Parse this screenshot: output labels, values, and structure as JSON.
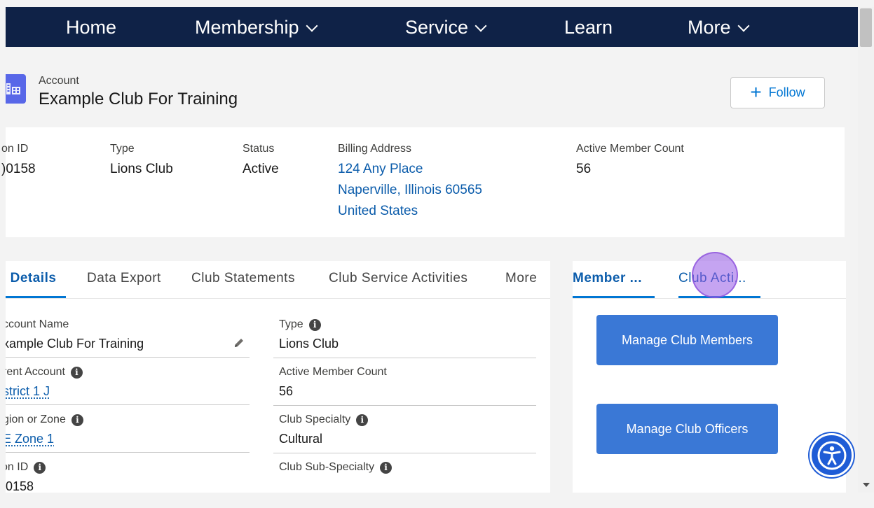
{
  "nav": {
    "items": [
      {
        "label": "Home",
        "dropdown": false
      },
      {
        "label": "Membership",
        "dropdown": true
      },
      {
        "label": "Service",
        "dropdown": true
      },
      {
        "label": "Learn",
        "dropdown": false
      },
      {
        "label": "More",
        "dropdown": true
      }
    ]
  },
  "header": {
    "object_label": "Account",
    "title": "Example Club For Training",
    "follow_label": "Follow",
    "icon": "building-icon"
  },
  "highlights": {
    "id_label": "on ID",
    "id_value": ")0158",
    "type_label": "Type",
    "type_value": "Lions Club",
    "status_label": "Status",
    "status_value": "Active",
    "billing_label": "Billing Address",
    "billing_line1": "124 Any Place",
    "billing_line2": "Naperville, Illinois 60565",
    "billing_line3": "United States",
    "count_label": "Active Member Count",
    "count_value": "56"
  },
  "tabs": {
    "items": [
      "› Details",
      "Data Export",
      "Club Statements",
      "Club Service Activities",
      "More"
    ],
    "active": 0
  },
  "details": {
    "account_name_label": "ccount Name",
    "account_name_value": "xample Club For Training",
    "parent_label": "rent Account",
    "parent_value": "strict 1 J",
    "region_label": "gion or Zone",
    "region_value": "E Zone 1",
    "id_label": "on ID",
    "id_value": ")0158",
    "type_label": "Type",
    "type_value": "Lions Club",
    "count_label": "Active Member Count",
    "count_value": "56",
    "specialty_label": "Club Specialty",
    "specialty_value": "Cultural",
    "subspecialty_label": "Club Sub-Specialty"
  },
  "right_panel": {
    "tab1": "Member ...",
    "tab2": "Club Acti...",
    "btn_members": "Manage Club Members",
    "btn_officers": "Manage Club Officers"
  },
  "colors": {
    "nav_bg": "#0f2247",
    "brand_blue": "#0176d3",
    "button_blue": "#3a78d6",
    "link_blue": "#0b5cab"
  }
}
